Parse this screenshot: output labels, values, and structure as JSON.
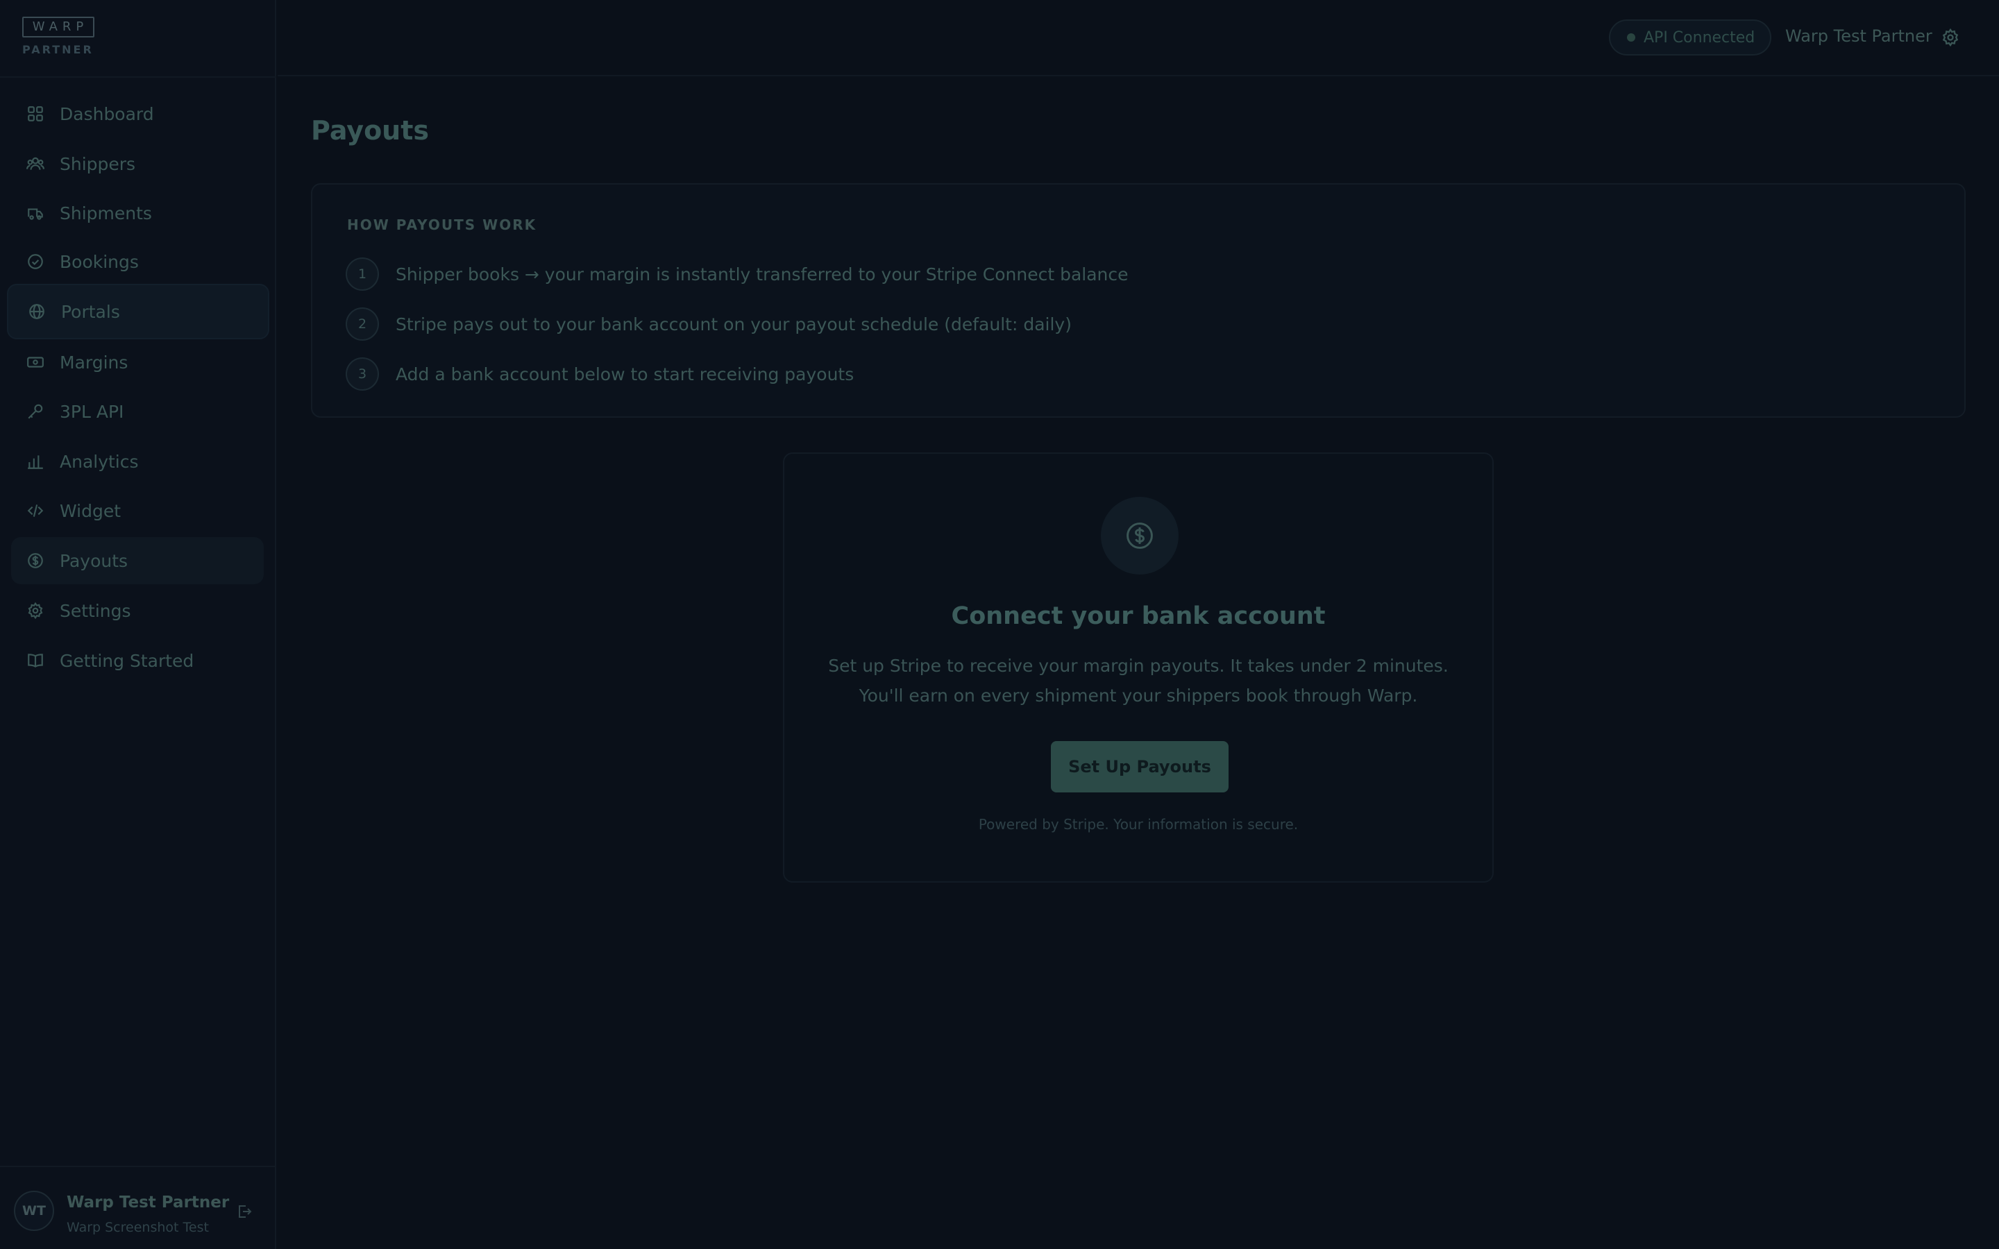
{
  "brand": {
    "logo": "WARP",
    "sub": "PARTNER"
  },
  "sidebar": {
    "items": [
      {
        "label": "Dashboard",
        "icon": "grid-icon"
      },
      {
        "label": "Shippers",
        "icon": "users-icon"
      },
      {
        "label": "Shipments",
        "icon": "truck-icon"
      },
      {
        "label": "Bookings",
        "icon": "check-circle-icon"
      },
      {
        "label": "Portals",
        "icon": "globe-icon"
      },
      {
        "label": "Margins",
        "icon": "banknote-icon"
      },
      {
        "label": "3PL API",
        "icon": "key-icon"
      },
      {
        "label": "Analytics",
        "icon": "bar-chart-icon"
      },
      {
        "label": "Widget",
        "icon": "code-icon"
      },
      {
        "label": "Payouts",
        "icon": "dollar-circle-icon"
      },
      {
        "label": "Settings",
        "icon": "gear-icon"
      },
      {
        "label": "Getting Started",
        "icon": "book-icon"
      }
    ]
  },
  "user": {
    "initials": "WT",
    "name": "Warp Test Partner",
    "org": "Warp Screenshot Test"
  },
  "topbar": {
    "api_status": "API Connected",
    "user_name": "Warp Test Partner"
  },
  "page": {
    "title": "Payouts"
  },
  "how": {
    "title": "HOW PAYOUTS WORK",
    "steps": [
      {
        "num": "1",
        "text": "Shipper books → your margin is instantly transferred to your Stripe Connect balance"
      },
      {
        "num": "2",
        "text": "Stripe pays out to your bank account on your payout schedule (default: daily)"
      },
      {
        "num": "3",
        "text": "Add a bank account below to start receiving payouts"
      }
    ]
  },
  "connect": {
    "title": "Connect your bank account",
    "desc_line1": "Set up Stripe to receive your margin payouts. It takes under 2 minutes.",
    "desc_line2": "You'll earn on every shipment your shippers book through Warp.",
    "button": "Set Up Payouts",
    "powered": "Powered by Stripe. Your information is secure."
  },
  "colors": {
    "background": "#0a1019",
    "accent": "#2b4a47",
    "text": "#3b5756"
  }
}
